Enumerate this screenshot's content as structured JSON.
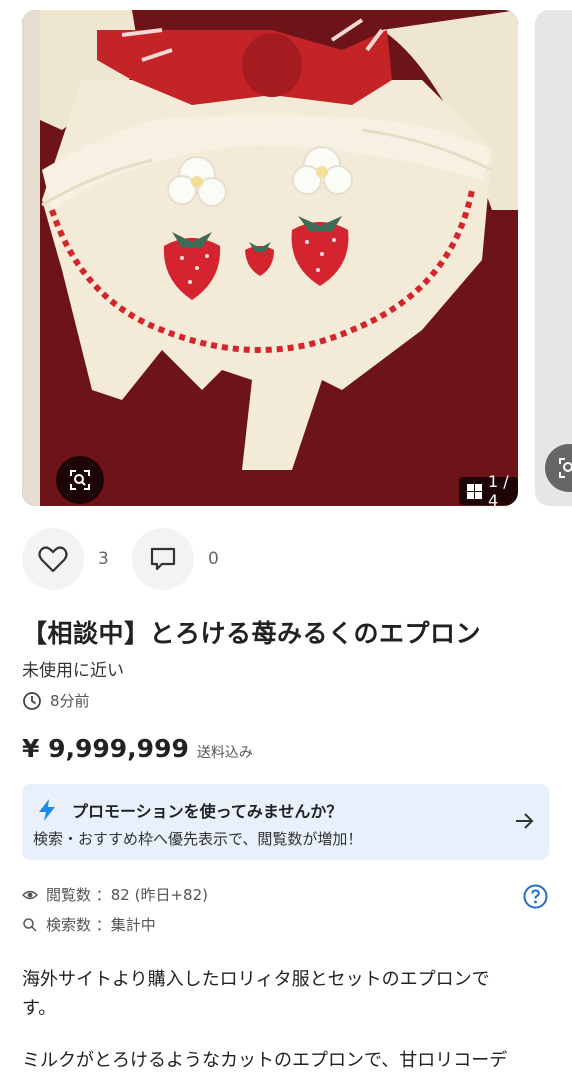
{
  "gallery": {
    "counter": "1 / 4",
    "colors": {
      "cream": "#f3ead7",
      "ribbon": "#c42427",
      "background": "#6d1418"
    }
  },
  "actions": {
    "likes": "3",
    "comments": "0"
  },
  "item": {
    "title": "【相談中】とろける苺みるくのエプロン",
    "condition": "未使用に近い",
    "posted": "8分前",
    "price": "¥ 9,999,999",
    "shipping": "送料込み"
  },
  "promo": {
    "title": "プロモーションを使ってみませんか？",
    "description": "検索・おすすめ枠へ優先表示で、閲覧数が増加！",
    "accent": "#1f8be8"
  },
  "stats": {
    "views": "閲覧数 ：82 (昨日+82)",
    "searches": "検索数 ：集計中"
  },
  "description": {
    "paragraph1_line1": "海外サイトより購入したロリィタ服とセットのエプロンで",
    "paragraph1_line2": "す。",
    "paragraph2_line1": "ミルクがとろけるようなカットのエプロンで、甘ロリコーデ"
  }
}
